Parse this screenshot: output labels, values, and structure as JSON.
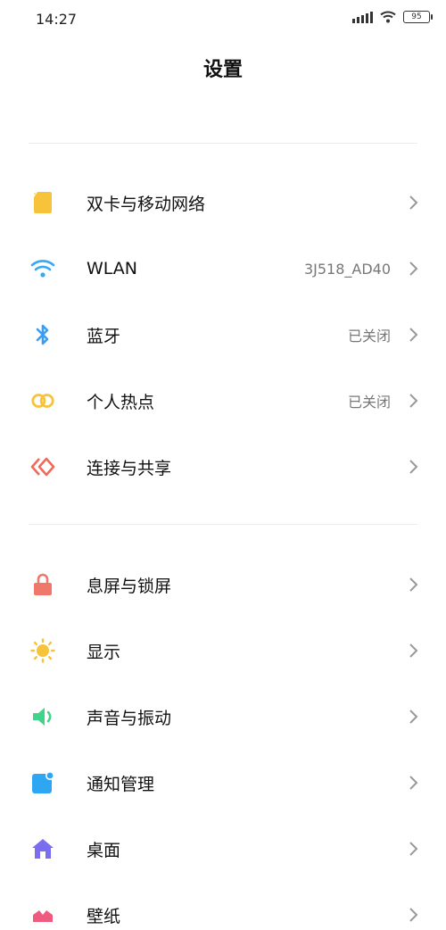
{
  "status_bar": {
    "time": "14:27",
    "battery": "95"
  },
  "header": {
    "title": "设置"
  },
  "section1": [
    {
      "label": "双卡与移动网络",
      "value": "",
      "icon": "sim-card-icon",
      "color": "#f6c33b"
    },
    {
      "label": "WLAN",
      "value": "3J518_AD40",
      "icon": "wifi-icon",
      "color": "#36a8f4"
    },
    {
      "label": "蓝牙",
      "value": "已关闭",
      "icon": "bluetooth-icon",
      "color": "#3a9ff2"
    },
    {
      "label": "个人热点",
      "value": "已关闭",
      "icon": "hotspot-icon",
      "color": "#f6c33b"
    },
    {
      "label": "连接与共享",
      "value": "",
      "icon": "share-icon",
      "color": "#ef6b5a"
    }
  ],
  "section2": [
    {
      "label": "息屏与锁屏",
      "value": "",
      "icon": "lock-icon",
      "color": "#f0786a"
    },
    {
      "label": "显示",
      "value": "",
      "icon": "sun-icon",
      "color": "#f6c33b"
    },
    {
      "label": "声音与振动",
      "value": "",
      "icon": "speaker-icon",
      "color": "#3fd48a"
    },
    {
      "label": "通知管理",
      "value": "",
      "icon": "notification-icon",
      "color": "#2fa6f2"
    },
    {
      "label": "桌面",
      "value": "",
      "icon": "home-icon",
      "color": "#7b6df0"
    },
    {
      "label": "壁纸",
      "value": "",
      "icon": "wallpaper-icon",
      "color": "#ef5b7e"
    }
  ]
}
